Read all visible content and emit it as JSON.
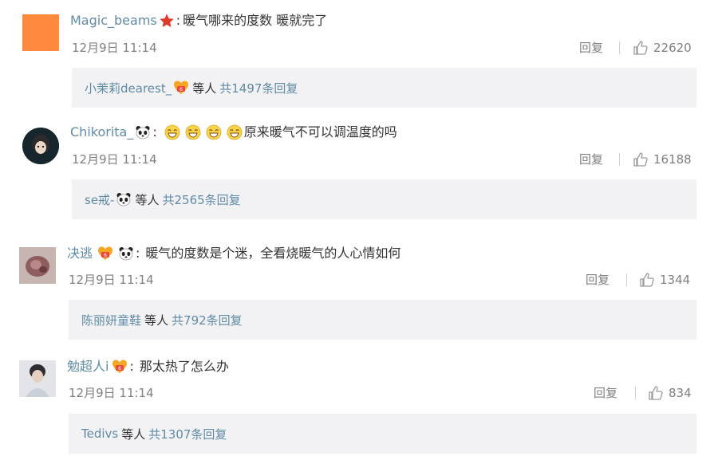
{
  "comments": [
    {
      "username": "Magic_beams",
      "badge_icon": "red-star-icon",
      "text": "暖气哪来的度数 暖就完了",
      "date": "12月9日 11:14",
      "reply_label": "回复",
      "likes": "22620",
      "sub": {
        "name": "小茉莉dearest_",
        "badge_icon": "vip-heart-icon",
        "etc": "等人",
        "total": "共1497条回复"
      }
    },
    {
      "username": "Chikorita_",
      "badge_icon": "panda-icon",
      "emojis": [
        "grin-emoji",
        "grin-emoji",
        "grin-emoji",
        "grin-emoji"
      ],
      "text": "原来暖气不可以调温度的吗",
      "date": "12月9日 11:14",
      "reply_label": "回复",
      "likes": "16188",
      "sub": {
        "name": "se戒-",
        "badge_icon": "panda-icon",
        "etc": "等人",
        "total": "共2565条回复"
      }
    },
    {
      "username": "决逃",
      "badge_icon": "vip-heart-icon",
      "badge_icon_2": "panda-icon",
      "text": "暖气的度数是个迷，全看烧暖气的人心情如何",
      "date": "12月9日 11:14",
      "reply_label": "回复",
      "likes": "1344",
      "sub": {
        "name": "陈丽妍童鞋",
        "etc": "等人",
        "total": "共792条回复"
      }
    },
    {
      "username": "勉超人i",
      "badge_icon": "vip-heart-icon",
      "text": "那太热了怎么办",
      "date": "12月9日 11:14",
      "reply_label": "回复",
      "likes": "834",
      "sub": {
        "name": "Tedivs",
        "etc": "等人",
        "total": "共1307条回复"
      }
    }
  ],
  "colors": {
    "username": "#5f8ba5",
    "meta": "#808080",
    "reply_box_bg": "#f2f2f5",
    "avatar_orange": "#ff8a3d"
  }
}
